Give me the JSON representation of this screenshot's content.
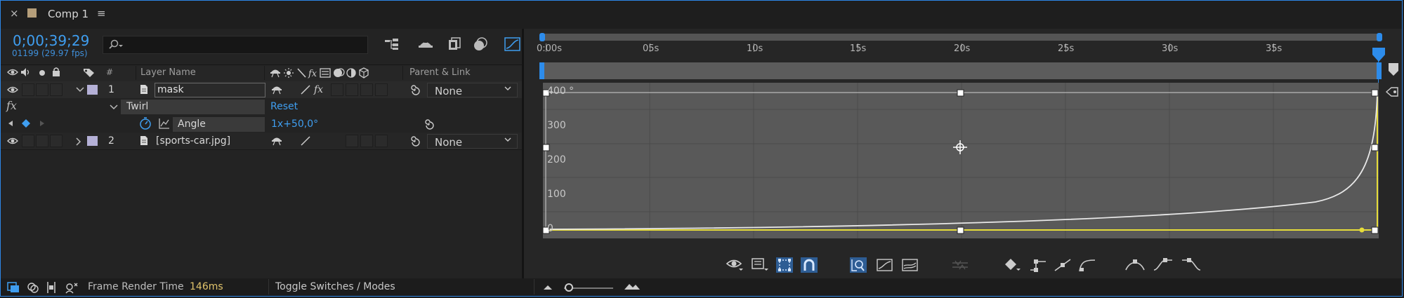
{
  "tab": {
    "close_symbol": "×",
    "title": "Comp 1",
    "menu_symbol": "≡"
  },
  "timecode": {
    "current": "0;00;39;29",
    "frame_info": "01199 (29.97 fps)"
  },
  "search": {
    "placeholder": "",
    "icon": "search-icon"
  },
  "columns": {
    "hash": "#",
    "layer_name": "Layer Name",
    "parent_link": "Parent & Link"
  },
  "layers": [
    {
      "number": "1",
      "name": "mask",
      "parent": "None",
      "label_color": "#b4b0d6"
    },
    {
      "number": "2",
      "name": "[sports-car.jpg]",
      "parent": "None",
      "label_color": "#b4b0d6"
    }
  ],
  "effect": {
    "fx_label": "fx",
    "name": "Twirl",
    "reset": "Reset"
  },
  "property": {
    "name": "Angle",
    "value": "1x+50,0°"
  },
  "timeline": {
    "ticks": [
      "0:00s",
      "05s",
      "10s",
      "15s",
      "20s",
      "25s",
      "30s",
      "35s"
    ]
  },
  "graph": {
    "y_labels": [
      "400 °",
      "300",
      "200",
      "100",
      "0"
    ],
    "curve_color": "#e8e8e8",
    "selected_color": "#e6dc3a",
    "accent": "#2d8ceb"
  },
  "status": {
    "frame_render_label": "Frame Render Time",
    "frame_render_value": "146ms",
    "toggle_label": "Toggle Switches / Modes"
  }
}
